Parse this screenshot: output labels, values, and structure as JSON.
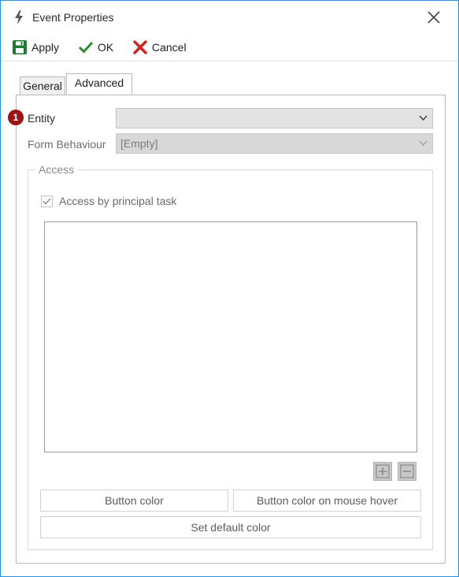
{
  "window": {
    "title": "Event Properties"
  },
  "toolbar": {
    "apply_label": "Apply",
    "ok_label": "OK",
    "cancel_label": "Cancel"
  },
  "tabs": [
    {
      "label": "General"
    },
    {
      "label": "Advanced"
    }
  ],
  "advanced": {
    "badge": "1",
    "entity_label": "Entity",
    "entity_value": "",
    "form_behaviour_label": "Form Behaviour",
    "form_behaviour_value": "[Empty]",
    "access_group_title": "Access",
    "access_by_principal_label": "Access by principal task",
    "access_by_principal_checked": true,
    "button_color_label": "Button color",
    "button_color_hover_label": "Button color on mouse hover",
    "set_default_color_label": "Set default color"
  },
  "colors": {
    "window_border": "#2b8fe0",
    "apply_icon": "#1e7b34",
    "ok_icon": "#2e8b2e",
    "cancel_icon": "#d42020",
    "badge": "#9e1414"
  }
}
